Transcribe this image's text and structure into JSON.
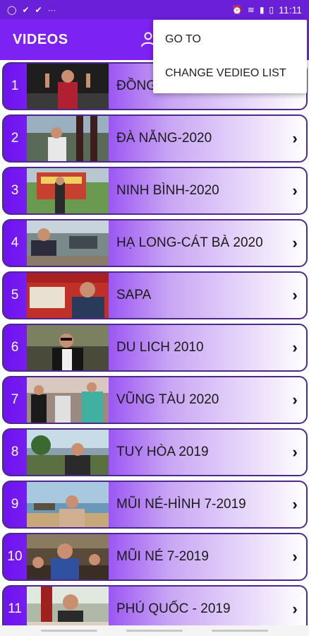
{
  "status_bar": {
    "time": "11:11"
  },
  "app_bar": {
    "title": "VIDEOS"
  },
  "menu": {
    "items": [
      "GO TO",
      "CHANGE VEDIEO LIST"
    ]
  },
  "videos": [
    {
      "num": "1",
      "title": "ĐỒNG"
    },
    {
      "num": "2",
      "title": "ĐÀ NẴNG-2020"
    },
    {
      "num": "3",
      "title": "NINH BÌNH-2020"
    },
    {
      "num": "4",
      "title": "HẠ LONG-CÁT BÀ 2020"
    },
    {
      "num": "5",
      "title": "SAPA"
    },
    {
      "num": "6",
      "title": "DU LICH 2010"
    },
    {
      "num": "7",
      "title": "VŨNG TÀU 2020"
    },
    {
      "num": "8",
      "title": "TUY HÒA 2019"
    },
    {
      "num": "9",
      "title": "MŨI NÉ-HÌNH 7-2019"
    },
    {
      "num": "10",
      "title": "MŨI NÉ  7-2019"
    },
    {
      "num": "11",
      "title": "PHÚ QUỐC - 2019"
    }
  ],
  "colors": {
    "app_bar": "#7c22f2",
    "status_bar": "#6a1fd8"
  }
}
